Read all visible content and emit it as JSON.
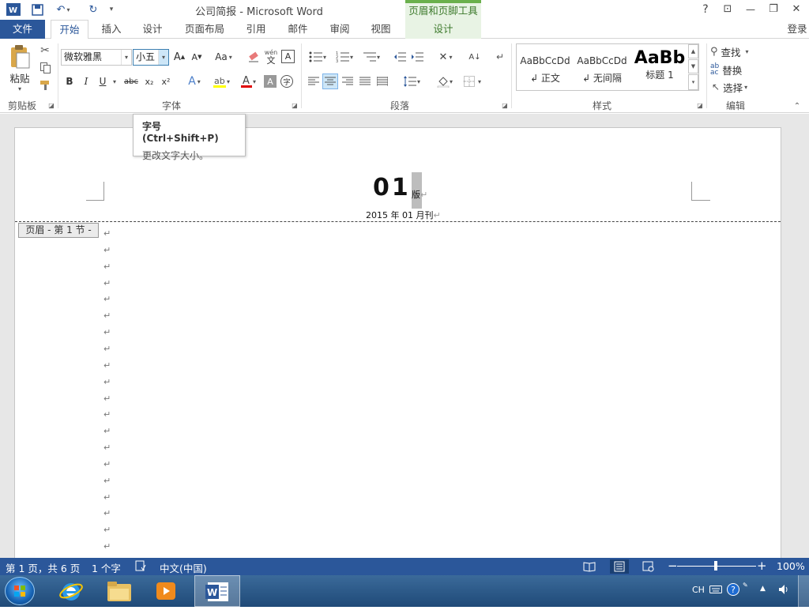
{
  "app": {
    "title": "公司简报 - Microsoft Word",
    "context_tab_group": "页眉和页脚工具",
    "login": "登录"
  },
  "titlebar_controls": {
    "help": "?",
    "ribbon_options": "⊡",
    "minimize": "—",
    "restore": "❐",
    "close": "✕"
  },
  "tabs": [
    "文件",
    "开始",
    "插入",
    "设计",
    "页面布局",
    "引用",
    "邮件",
    "审阅",
    "视图",
    "设计"
  ],
  "clipboard": {
    "paste": "粘贴",
    "group": "剪贴板"
  },
  "font": {
    "name": "微软雅黑",
    "size": "小五",
    "group": "字体",
    "bold": "B",
    "italic": "I",
    "underline": "U",
    "strike": "abc",
    "sub": "x₂",
    "sup": "x²",
    "grow": "A",
    "shrink": "A",
    "case": "Aa",
    "phonetic_top": "wén",
    "phonetic_bottom": "文",
    "border_char": "A"
  },
  "paragraph": {
    "group": "段落"
  },
  "styles": {
    "group": "样式",
    "items": [
      {
        "preview": "AaBbCcDd",
        "name": "↲ 正文"
      },
      {
        "preview": "AaBbCcDd",
        "name": "↲ 无间隔"
      },
      {
        "preview": "AaBb",
        "name": "标题 1"
      }
    ]
  },
  "editing": {
    "group": "编辑",
    "find": "查找",
    "replace": "替换",
    "select": "选择"
  },
  "tooltip": {
    "title": "字号 (Ctrl+Shift+P)",
    "body": "更改文字大小。"
  },
  "document": {
    "header_number": "01",
    "header_suffix": "版",
    "header_date": "2015 年 01 月刊",
    "section_tag": "页眉 - 第 1 节 -",
    "para_mark": "↵"
  },
  "status": {
    "page": "第 1 页，共 6 页",
    "words": "1 个字",
    "lang": "中文(中国)",
    "zoom": "100%"
  },
  "taskbar": {
    "ime": "CH"
  },
  "colors": {
    "accent": "#2b579a",
    "context": "#e8f3e4",
    "context_border": "#6ab04c"
  }
}
